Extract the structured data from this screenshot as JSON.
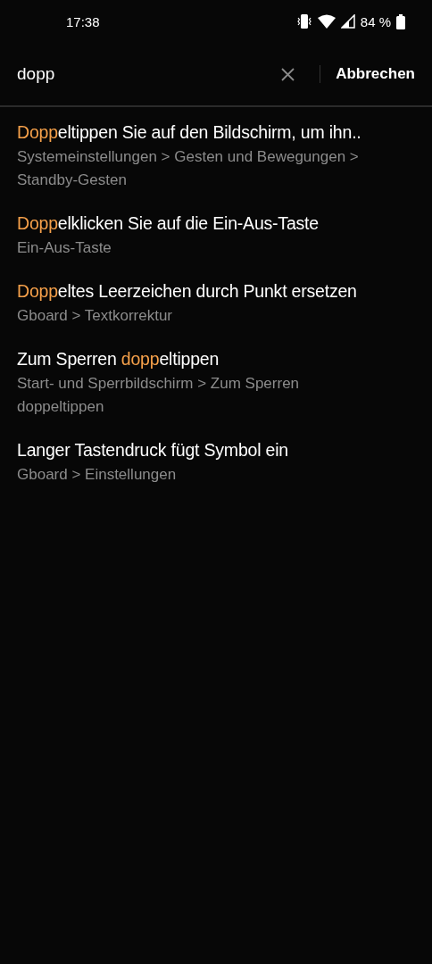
{
  "status_bar": {
    "time": "17:38",
    "battery": "84 %"
  },
  "search": {
    "value": "dopp",
    "cancel": "Abbrechen"
  },
  "results": [
    {
      "title": [
        {
          "text": "Dopp",
          "highlight": true
        },
        {
          "text": "eltippen Sie auf den Bildschirm, um ihn..",
          "highlight": false
        }
      ],
      "path": "Systemeinstellungen > Gesten und Bewegungen > Standby-Gesten"
    },
    {
      "title": [
        {
          "text": "Dopp",
          "highlight": true
        },
        {
          "text": "elklicken Sie auf die Ein-Aus-Taste",
          "highlight": false
        }
      ],
      "path": "Ein-Aus-Taste"
    },
    {
      "title": [
        {
          "text": "Dopp",
          "highlight": true
        },
        {
          "text": "eltes Leerzeichen durch Punkt ersetzen",
          "highlight": false
        }
      ],
      "path": "Gboard > Textkorrektur"
    },
    {
      "title": [
        {
          "text": "Zum Sperren ",
          "highlight": false
        },
        {
          "text": "dopp",
          "highlight": true
        },
        {
          "text": "eltippen",
          "highlight": false
        }
      ],
      "path": "Start- und Sperrbildschirm > Zum Sperren doppeltippen"
    },
    {
      "title": [
        {
          "text": "Langer Tastendruck fügt Symbol ein",
          "highlight": false
        }
      ],
      "path": "Gboard > Einstellungen"
    }
  ]
}
